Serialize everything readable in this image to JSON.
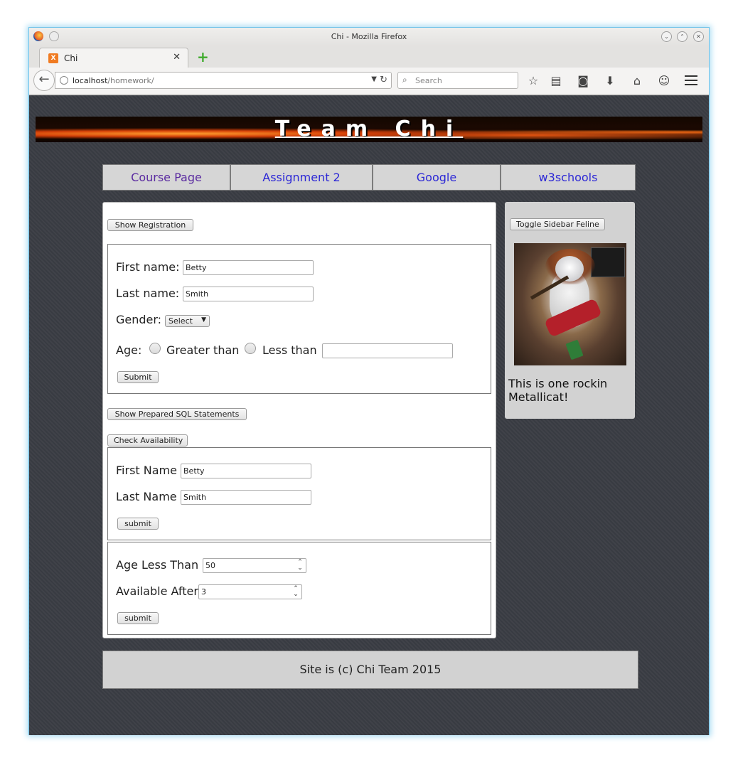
{
  "browser": {
    "window_title": "Chi - Mozilla Firefox",
    "tab_title": "Chi",
    "url_host": "localhost",
    "url_path": "/homework/",
    "search_placeholder": "Search"
  },
  "site": {
    "banner_title": "Team Chi",
    "nav": [
      {
        "label": "Course Page"
      },
      {
        "label": "Assignment 2"
      },
      {
        "label": "Google"
      },
      {
        "label": "w3schools"
      }
    ],
    "footer": "Site is (c) Chi Team 2015"
  },
  "main": {
    "show_registration_label": "Show Registration",
    "registration": {
      "first_name_label": "First name:",
      "first_name_value": "Betty",
      "last_name_label": "Last name:",
      "last_name_value": "Smith",
      "gender_label": "Gender:",
      "gender_value": "Select",
      "age_label": "Age:",
      "greater_than_label": "Greater than",
      "less_than_label": "Less than",
      "age_value": "",
      "submit_label": "Submit"
    },
    "show_sql_label": "Show Prepared SQL Statements",
    "check_availability_label": "Check Availability",
    "availability_name": {
      "first_name_label": "First Name",
      "first_name_value": "Betty",
      "last_name_label": "Last Name",
      "last_name_value": "Smith",
      "submit_label": "submit"
    },
    "availability_age": {
      "age_less_than_label": "Age Less Than",
      "age_less_than_value": "50",
      "available_after_label": "Available After",
      "available_after_value": "3",
      "submit_label": "submit"
    }
  },
  "sidebar": {
    "toggle_label": "Toggle Sidebar Feline",
    "caption": "This is one rockin Metallicat!"
  }
}
